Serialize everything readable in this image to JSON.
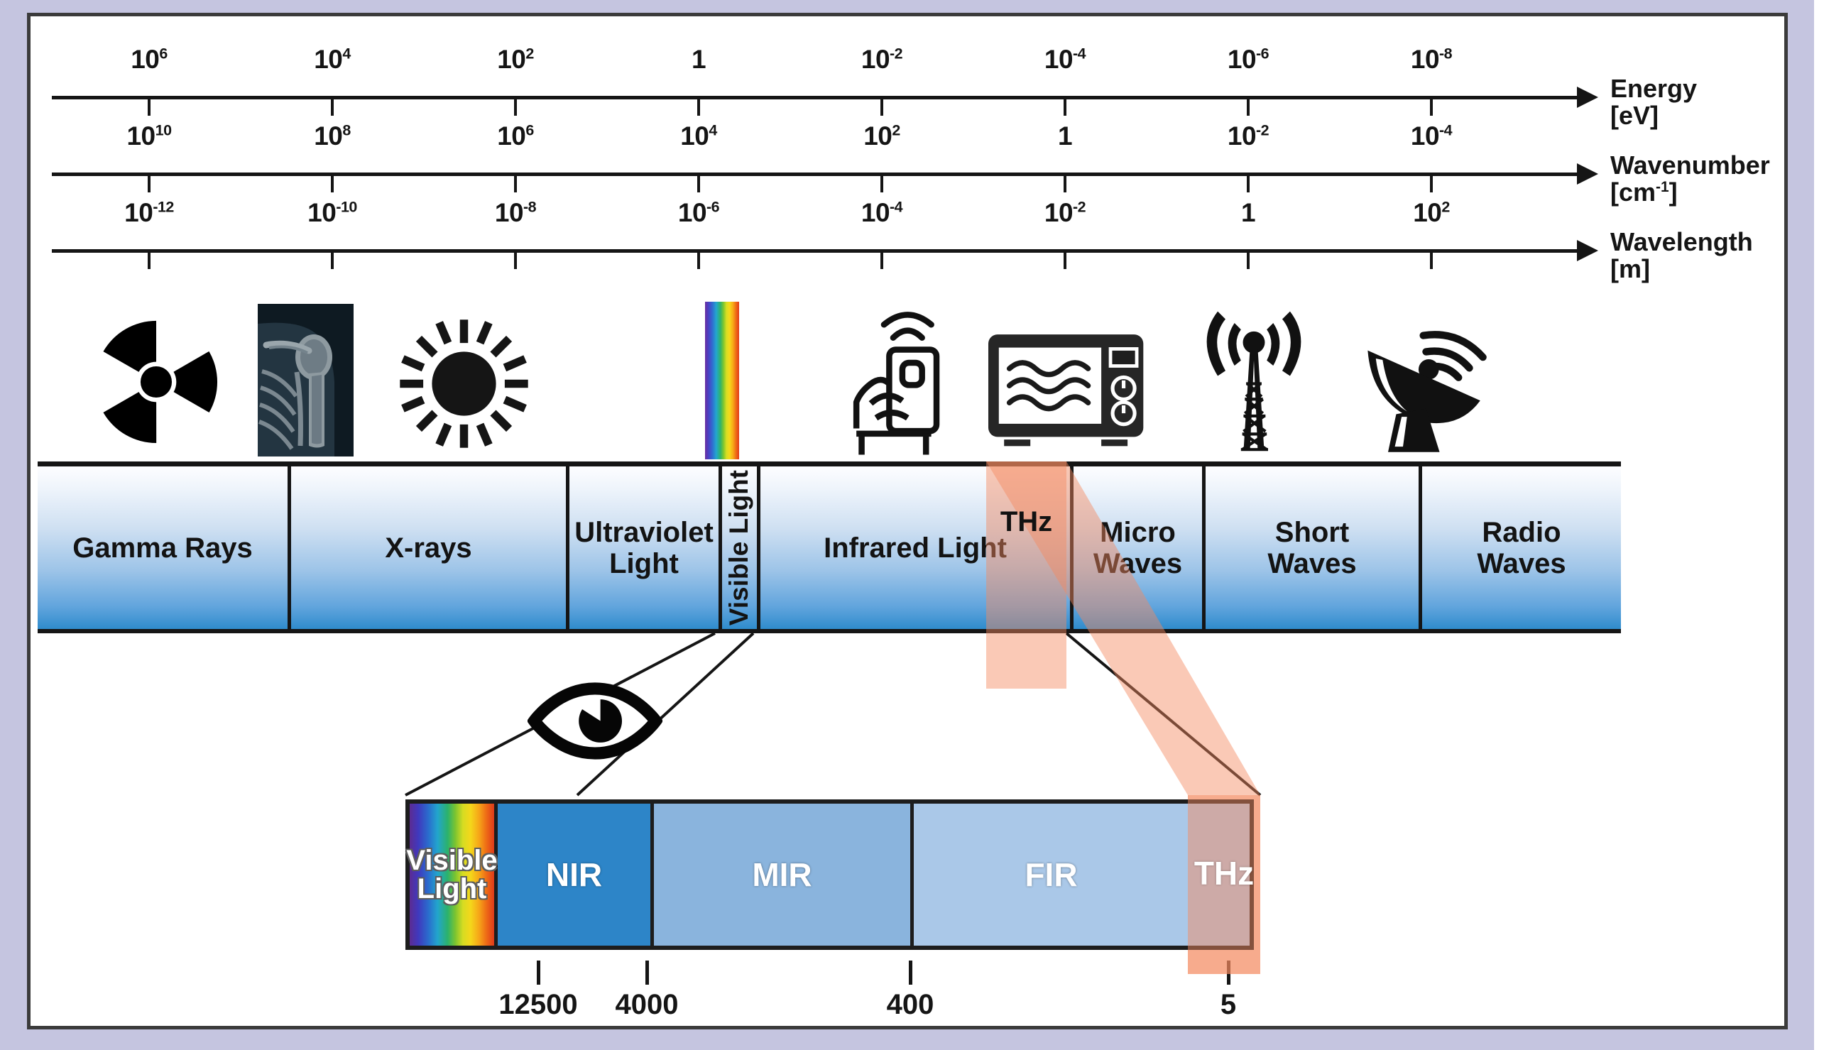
{
  "figure": {
    "title": "Electromagnetic Spectrum Overview"
  },
  "axes": [
    {
      "name": "Energy",
      "unit": "[eV]",
      "unit_base": "",
      "unit_sup": "",
      "ticks": [
        "10⁶",
        "10⁴",
        "10²",
        "1",
        "10⁻²",
        "10⁻⁴",
        "10⁻⁶",
        "10⁻⁸"
      ],
      "tick_mantissa": [
        "10",
        "10",
        "10",
        "1",
        "10",
        "10",
        "10",
        "10"
      ],
      "tick_exp": [
        "6",
        "4",
        "2",
        "",
        "-2",
        "-4",
        "-6",
        "-8"
      ]
    },
    {
      "name": "Wavenumber",
      "unit_base": "[cm",
      "unit_sup": "-1",
      "unit_close": "]",
      "unit": "[cm⁻¹]",
      "ticks": [
        "10¹⁰",
        "10⁸",
        "10⁶",
        "10⁴",
        "10²",
        "1",
        "10⁻²",
        "10⁻⁴"
      ],
      "tick_mantissa": [
        "10",
        "10",
        "10",
        "10",
        "10",
        "1",
        "10",
        "10"
      ],
      "tick_exp": [
        "10",
        "8",
        "6",
        "4",
        "2",
        "",
        "-2",
        "-4"
      ]
    },
    {
      "name": "Wavelength",
      "unit": "[m]",
      "unit_base": "",
      "unit_sup": "",
      "ticks": [
        "10⁻¹²",
        "10⁻¹⁰",
        "10⁻⁸",
        "10⁻⁶",
        "10⁻⁴",
        "10⁻²",
        "1",
        "10²"
      ],
      "tick_mantissa": [
        "10",
        "10",
        "10",
        "10",
        "10",
        "10",
        "1",
        "10"
      ],
      "tick_exp": [
        "-12",
        "-10",
        "-8",
        "-6",
        "-4",
        "-2",
        "",
        "2"
      ]
    }
  ],
  "icons": [
    {
      "name": "radiation-trefoil-icon",
      "label": "Radiation"
    },
    {
      "name": "xray-shoulder-image",
      "label": "X-ray image"
    },
    {
      "name": "sun-icon",
      "label": "Sun"
    },
    {
      "name": "rainbow-spectrum-strip",
      "label": "Rainbow"
    },
    {
      "name": "hand-remote-control-icon",
      "label": "Remote control"
    },
    {
      "name": "microwave-oven-icon",
      "label": "Microwave oven"
    },
    {
      "name": "radio-tower-icon",
      "label": "Radio tower"
    },
    {
      "name": "satellite-dish-icon",
      "label": "Satellite dish"
    }
  ],
  "spectrum": {
    "bands": [
      {
        "label": "Gamma Rays",
        "vertical": false
      },
      {
        "label": "X-rays",
        "vertical": false
      },
      {
        "label": "Ultraviolet\nLight",
        "vertical": false
      },
      {
        "label": "Visible Light",
        "vertical": true
      },
      {
        "label": "Infrared Light",
        "vertical": false
      },
      {
        "label": "Micro\nWaves",
        "vertical": false
      },
      {
        "label": "Short\nWaves",
        "vertical": false
      },
      {
        "label": "Radio\nWaves",
        "vertical": false
      }
    ],
    "thz_label": "THz",
    "highlight_color": "#f48a60"
  },
  "zoom_detail": {
    "bands": [
      {
        "label": "Visible\nLight",
        "color": "rainbow"
      },
      {
        "label": "NIR",
        "color": "#2d85c8"
      },
      {
        "label": "MIR",
        "color": "#8ab4dd"
      },
      {
        "label": "FIR",
        "color": "#aac8e8"
      }
    ],
    "thz_label": "THz",
    "scale_values": [
      "12500",
      "4000",
      "400",
      "5"
    ],
    "scale_unit_implied": "cm⁻¹"
  },
  "chart_data": {
    "type": "table",
    "title": "Electromagnetic Spectrum",
    "axis_series": [
      {
        "name": "Energy",
        "unit": "eV",
        "values": [
          1000000.0,
          10000.0,
          100.0,
          1,
          0.01,
          0.0001,
          1e-06,
          1e-08
        ]
      },
      {
        "name": "Wavenumber",
        "unit": "cm^-1",
        "values": [
          10000000000.0,
          100000000.0,
          1000000.0,
          10000.0,
          100.0,
          1,
          0.01,
          0.0001
        ]
      },
      {
        "name": "Wavelength",
        "unit": "m",
        "values": [
          1e-12,
          1e-10,
          1e-08,
          1e-06,
          0.0001,
          0.01,
          1,
          100.0
        ]
      }
    ],
    "bands": [
      "Gamma Rays",
      "X-rays",
      "Ultraviolet Light",
      "Visible Light",
      "Infrared Light",
      "Micro Waves",
      "Short Waves",
      "Radio Waves"
    ],
    "ir_subbands": [
      "Visible Light",
      "NIR",
      "MIR",
      "FIR",
      "THz"
    ],
    "ir_boundaries_cm1": [
      12500,
      4000,
      400,
      5
    ],
    "highlighted_region": "THz"
  }
}
